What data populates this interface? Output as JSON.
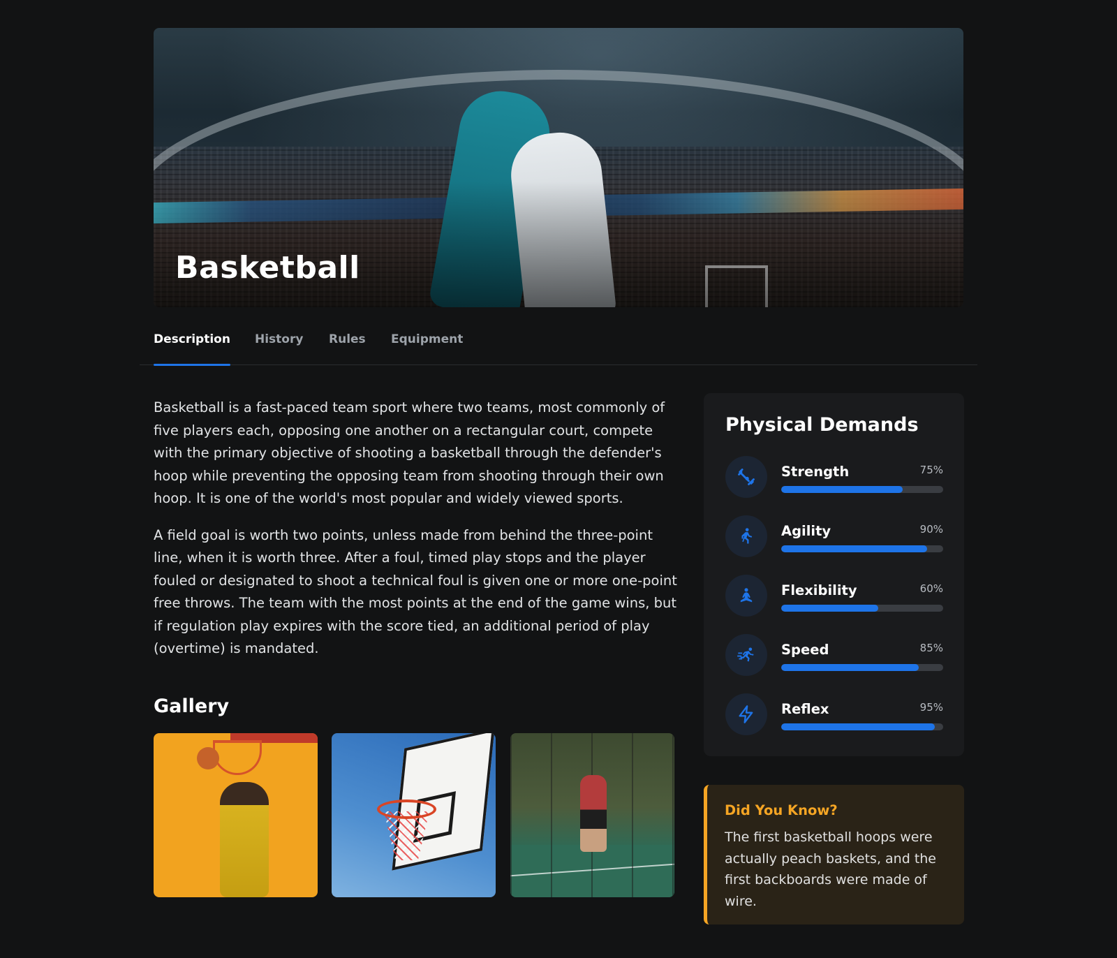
{
  "hero": {
    "title": "Basketball"
  },
  "tabs": [
    {
      "label": "Description",
      "active": true
    },
    {
      "label": "History",
      "active": false
    },
    {
      "label": "Rules",
      "active": false
    },
    {
      "label": "Equipment",
      "active": false
    }
  ],
  "description": {
    "paragraphs": [
      "Basketball is a fast-paced team sport where two teams, most commonly of five players each, opposing one another on a rectangular court, compete with the primary objective of shooting a basketball through the defender's hoop while preventing the opposing team from shooting through their own hoop. It is one of the world's most popular and widely viewed sports.",
      "A field goal is worth two points, unless made from behind the three-point line, when it is worth three. After a foul, timed play stops and the player fouled or designated to shoot a technical foul is given one or more one-point free throws. The team with the most points at the end of the game wins, but if regulation play expires with the score tied, an additional period of play (overtime) is mandated."
    ]
  },
  "gallery": {
    "title": "Gallery"
  },
  "demands": {
    "title": "Physical Demands",
    "stats": [
      {
        "label": "Strength",
        "value": "75%",
        "percent": 75,
        "icon": "strength-icon"
      },
      {
        "label": "Agility",
        "value": "90%",
        "percent": 90,
        "icon": "running-icon"
      },
      {
        "label": "Flexibility",
        "value": "60%",
        "percent": 60,
        "icon": "yoga-icon"
      },
      {
        "label": "Speed",
        "value": "85%",
        "percent": 85,
        "icon": "sprint-icon"
      },
      {
        "label": "Reflex",
        "value": "95%",
        "percent": 95,
        "icon": "lightning-icon"
      }
    ]
  },
  "tip": {
    "title": "Did You Know?",
    "text": "The first basketball hoops were actually peach baskets, and the first backboards were made of wire."
  },
  "colors": {
    "accent": "#1e74e8",
    "tip_accent": "#f5a524",
    "background": "#121314"
  }
}
